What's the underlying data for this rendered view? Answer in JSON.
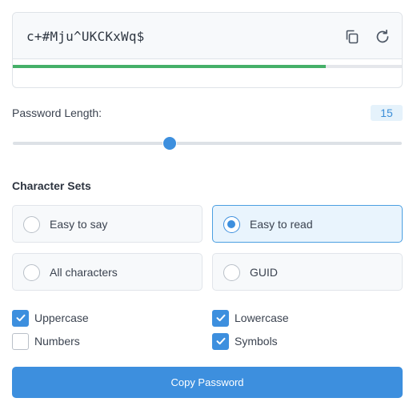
{
  "password": {
    "value": "c+#Mju^UKCKxWq$",
    "strength": 0.805,
    "strength_color": "#45b068",
    "copy_icon": "copy-icon",
    "refresh_icon": "refresh-icon"
  },
  "length": {
    "label": "Password Length:",
    "value": "15",
    "slider_fraction": 0.404
  },
  "character_sets": {
    "title": "Character Sets",
    "options": [
      {
        "label": "Easy to say",
        "selected": false
      },
      {
        "label": "Easy to read",
        "selected": true
      },
      {
        "label": "All characters",
        "selected": false
      },
      {
        "label": "GUID",
        "selected": false
      }
    ]
  },
  "checkboxes": [
    {
      "label": "Uppercase",
      "checked": true
    },
    {
      "label": "Lowercase",
      "checked": true
    },
    {
      "label": "Numbers",
      "checked": false
    },
    {
      "label": "Symbols",
      "checked": true
    }
  ],
  "copy_button": {
    "label": "Copy Password"
  },
  "colors": {
    "accent": "#3d8fde",
    "selected_bg": "#e9f4fd",
    "badge_bg": "#e5f2fb"
  }
}
